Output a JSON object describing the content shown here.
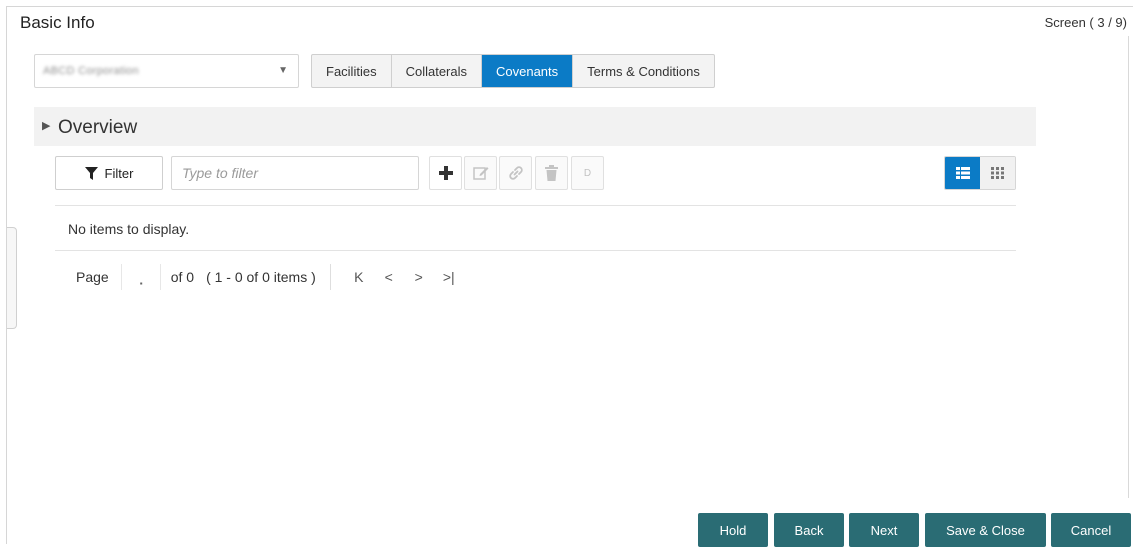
{
  "header": {
    "title": "Basic Info",
    "screen_counter": "Screen ( 3 / 9)"
  },
  "customer_select": {
    "value": "ABCD Corporation",
    "caret_icon": "chevron-down-icon"
  },
  "tabs": [
    {
      "label": "Facilities",
      "active": false
    },
    {
      "label": "Collaterals",
      "active": false
    },
    {
      "label": "Covenants",
      "active": true
    },
    {
      "label": "Terms & Conditions",
      "active": false
    }
  ],
  "overview": {
    "label": "Overview"
  },
  "toolbar": {
    "filter_label": "Filter",
    "filter_placeholder": "Type to filter",
    "d_label": "D"
  },
  "table": {
    "empty_message": "No items to display."
  },
  "pagination": {
    "page_label": "Page",
    "of_label": "of 0",
    "range_label": "( 1 - 0 of 0 items )",
    "first_symbol": "K",
    "prev_symbol": "<",
    "next_symbol": ">",
    "last_symbol": ">|"
  },
  "footer": {
    "hold": "Hold",
    "back": "Back",
    "next": "Next",
    "save_close": "Save & Close",
    "cancel": "Cancel"
  },
  "colors": {
    "accent": "#0b7bc6",
    "footer_button": "#2a6c74"
  }
}
